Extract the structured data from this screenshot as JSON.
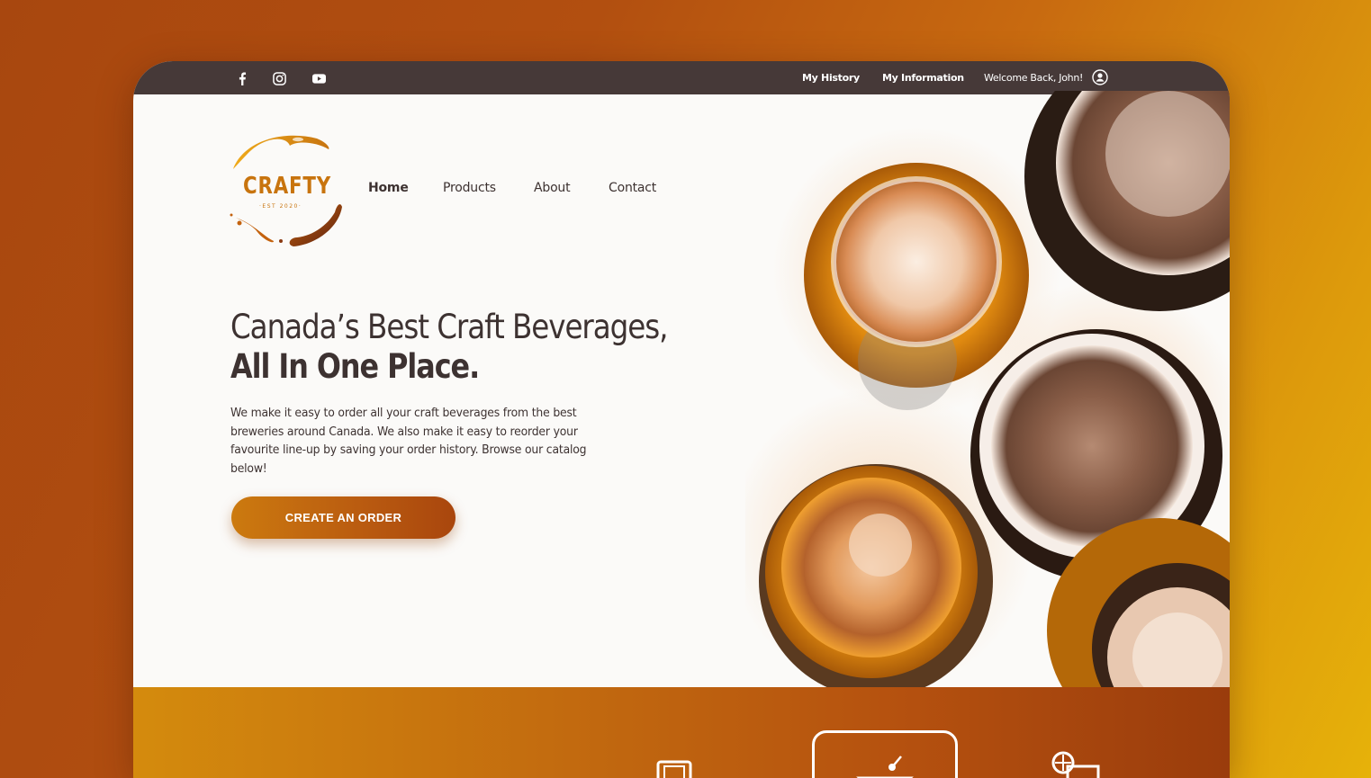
{
  "topbar": {
    "social": [
      "facebook-icon",
      "instagram-icon",
      "youtube-icon"
    ],
    "links": [
      "My History",
      "My Information"
    ],
    "welcome": "Welcome Back, John!",
    "user_icon": "user-circle-icon"
  },
  "logo": {
    "name": "CRAFTY",
    "tagline": "·EST 2020·"
  },
  "nav": {
    "items": [
      "Home",
      "Products",
      "About",
      "Contact"
    ],
    "active": "Home"
  },
  "hero": {
    "title_line1": "Canada’s Best Craft Beverages,",
    "title_line2": "All In One Place.",
    "paragraph": "We make it easy to order all your craft beverages from the best breweries around Canada. We also make it easy to reorder your favourite line-up by saving your order history. Browse our catalog below!",
    "cta": "CREATE AN ORDER"
  },
  "categories": {
    "icons": [
      "glass-icon",
      "cocktail-icon",
      "citrus-drink-icon"
    ]
  },
  "colors": {
    "topbar": "#463938",
    "accent": "#c8740e",
    "text": "#3d3231"
  }
}
